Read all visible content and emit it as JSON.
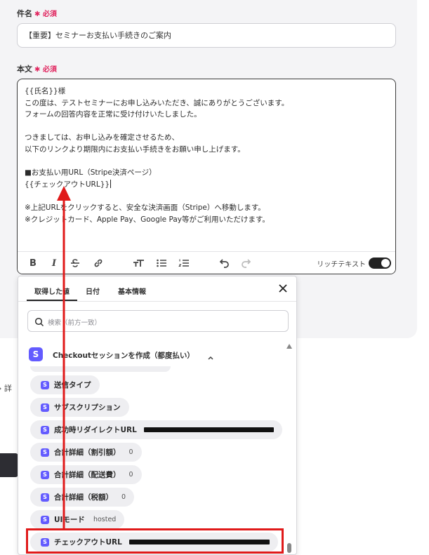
{
  "form": {
    "subject_label": "件名",
    "required_text": "✱ 必須",
    "subject_value": "【重要】セミナーお支払い手続きのご案内",
    "body_label": "本文",
    "body_lines": [
      "{{氏名}}様",
      "この度は、テストセミナーにお申し込みいただき、誠にありがとうございます。",
      "フォームの回答内容を正常に受け付けいたしました。",
      "",
      "つきましては、お申し込みを確定させるため、",
      "以下のリンクより期限内にお支払い手続きをお願い申し上げます。",
      "",
      "■お支払い用URL（Stripe決済ページ）",
      "{{チェックアウトURL}}",
      "",
      "※上記URLをクリックすると、安全な決済画面（Stripe）へ移動します。",
      "※クレジットカード、Apple Pay、Google Pay等がご利用いただけます。"
    ],
    "toolbar": {
      "rich_text_label": "リッチテキスト",
      "rich_text_on": true
    }
  },
  "side": {
    "detail_text": "› 詳"
  },
  "dropdown": {
    "tabs": [
      "取得した値",
      "日付",
      "基本情報"
    ],
    "active_tab": 0,
    "search_placeholder": "検索（前方一致）",
    "group_title": "Checkoutセッションを作成（都度払い）",
    "badge_letter": "S",
    "items": [
      {
        "label": "送信タイプ",
        "value": ""
      },
      {
        "label": "サブスクリプション",
        "value": ""
      },
      {
        "label": "成功時リダイレクトURL",
        "value": ""
      },
      {
        "label": "合計詳細（割引額）",
        "value": "0"
      },
      {
        "label": "合計詳細（配送費）",
        "value": "0"
      },
      {
        "label": "合計詳細（税額）",
        "value": "0"
      },
      {
        "label": "UIモード",
        "value": "hosted"
      },
      {
        "label": "チェックアウトURL",
        "value": ""
      }
    ]
  },
  "colors": {
    "stripe_badge": "#635bff",
    "annotation_red": "#e01a1a",
    "required_pink": "#e0245e"
  }
}
